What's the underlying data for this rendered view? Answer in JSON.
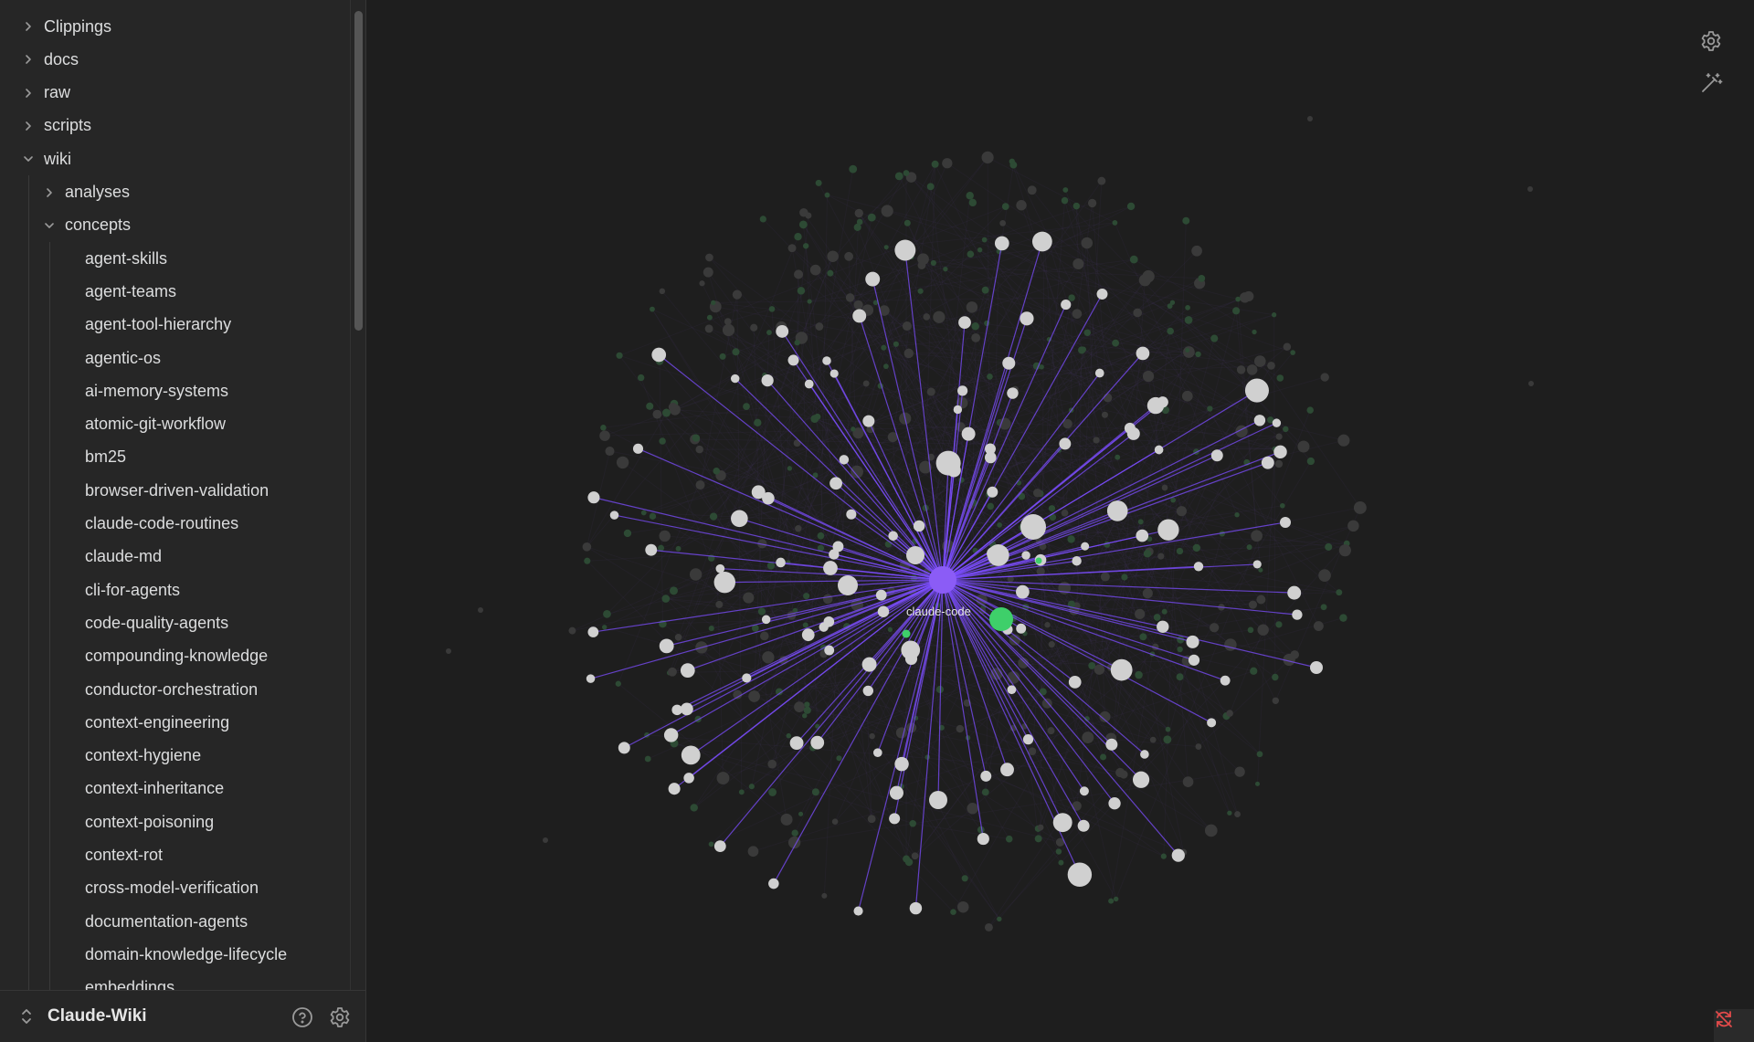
{
  "sidebar": {
    "top_folders": [
      {
        "label": "Clippings",
        "expanded": false
      },
      {
        "label": "docs",
        "expanded": false
      },
      {
        "label": "raw",
        "expanded": false
      },
      {
        "label": "scripts",
        "expanded": false
      },
      {
        "label": "wiki",
        "expanded": true
      }
    ],
    "wiki_children": [
      {
        "label": "analyses",
        "expanded": false
      },
      {
        "label": "concepts",
        "expanded": true
      }
    ],
    "concepts_files": [
      "agent-skills",
      "agent-teams",
      "agent-tool-hierarchy",
      "agentic-os",
      "ai-memory-systems",
      "atomic-git-workflow",
      "bm25",
      "browser-driven-validation",
      "claude-code-routines",
      "claude-md",
      "cli-for-agents",
      "code-quality-agents",
      "compounding-knowledge",
      "conductor-orchestration",
      "context-engineering",
      "context-hygiene",
      "context-inheritance",
      "context-poisoning",
      "context-rot",
      "cross-model-verification",
      "documentation-agents",
      "domain-knowledge-lifecycle",
      "embeddings"
    ]
  },
  "vault": {
    "name": "Claude-Wiki",
    "switch_icon": "chevron-up-down-icon",
    "help_icon": "help-circle-icon",
    "settings_icon": "gear-icon"
  },
  "graph": {
    "center_node_label": "claude-code",
    "colors": {
      "background": "#1e1e1e",
      "center_node": "#8b5cf6",
      "edge_highlight": "#7c4dff",
      "linked_node": "#d0d0d0",
      "tag_node": "#3ecf6a",
      "dim_node": "#3a3a3a",
      "dim_green": "#2d4a34"
    },
    "tools": {
      "settings_icon": "gear-icon",
      "animate_icon": "magic-wand-icon",
      "sync_icon": "sync-off-icon"
    }
  }
}
